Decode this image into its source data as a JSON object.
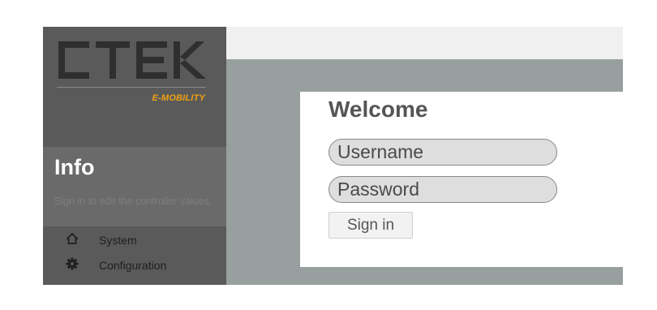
{
  "sidebar": {
    "logo_text": "CTEK",
    "tagline": "E-MOBILITY",
    "info": {
      "title": "Info",
      "description": "Sign in to edit the controller values."
    },
    "nav": [
      {
        "label": "System",
        "icon": "home-icon"
      },
      {
        "label": "Configuration",
        "icon": "gear-icon"
      }
    ]
  },
  "login": {
    "title": "Welcome",
    "username_placeholder": "Username",
    "password_placeholder": "Password",
    "signin_label": "Sign in"
  },
  "colors": {
    "sidebar_bg": "#5a5a5a",
    "info_bg": "#6a6a6a",
    "accent": "#f0a010",
    "main_bg": "#97a09f"
  }
}
